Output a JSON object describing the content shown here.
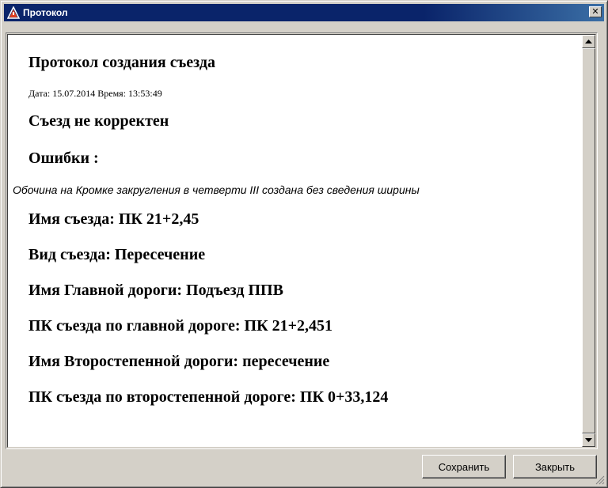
{
  "window": {
    "title": "Протокол",
    "close_symbol": "✕"
  },
  "report": {
    "heading": "Протокол создания съезда",
    "date_line": "Дата: 15.07.2014 Время: 13:53:49",
    "status": "Съезд не корректен",
    "errors_heading": "Ошибки :",
    "error_message": "Обочина на Кромке закругления в четверти III создана без сведения ширины",
    "exit_name": "Имя съезда: ПК 21+2,45",
    "exit_type": "Вид съезда: Пересечение",
    "main_road": "Имя Главной дороги: Подъезд ППВ",
    "main_road_pk": "ПК съезда по главной дороге: ПК 21+2,451",
    "secondary_road": "Имя Второстепенной дороги: пересечение",
    "secondary_road_pk": "ПК съезда по второстепенной дороге: ПК 0+33,124"
  },
  "buttons": {
    "save_label": "Сохранить",
    "close_label": "Закрыть"
  },
  "icons": {
    "app": "warning-triangle-icon",
    "scroll_up": "arrow-up-icon",
    "scroll_down": "arrow-down-icon",
    "grip": "resize-grip-icon"
  }
}
